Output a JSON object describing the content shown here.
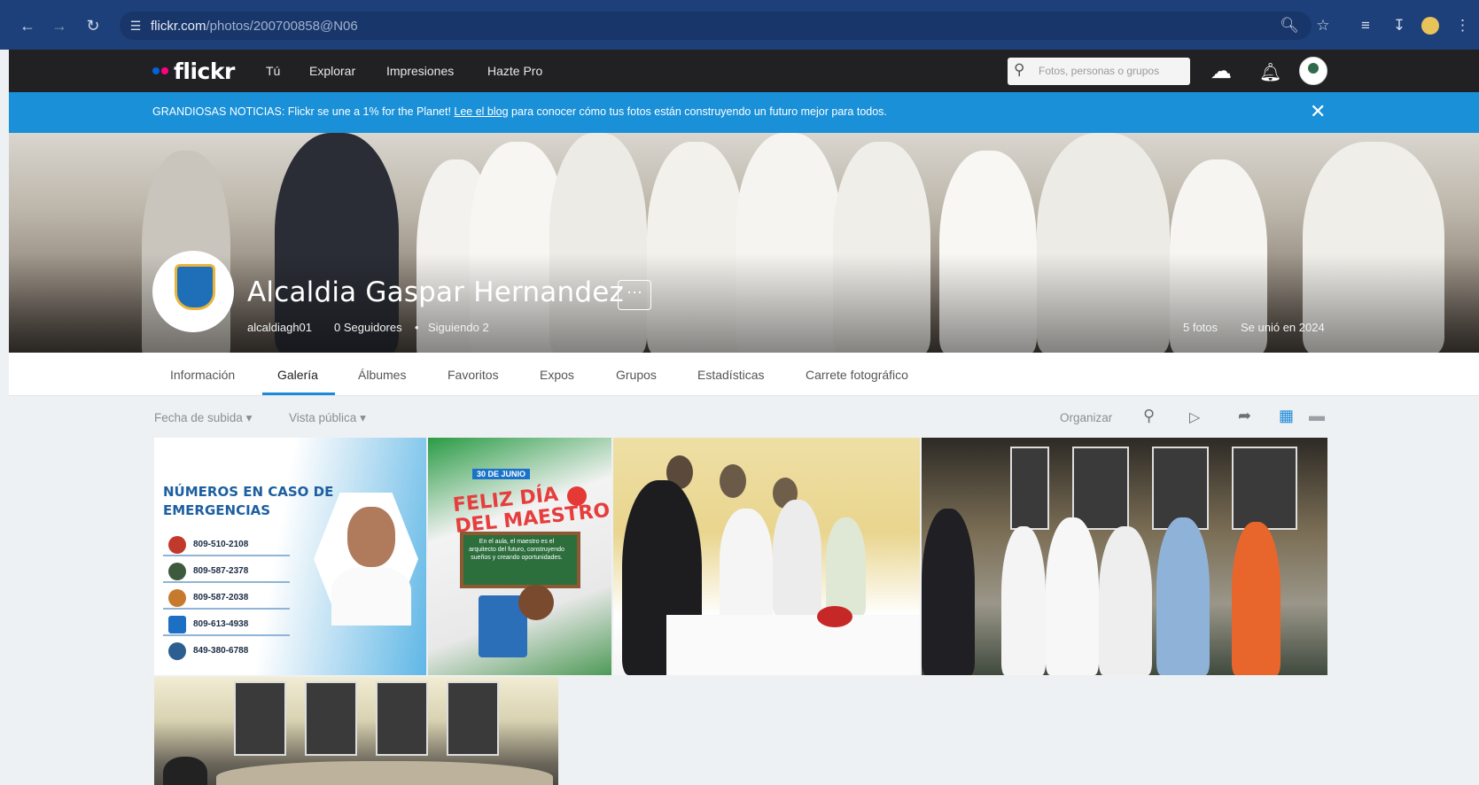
{
  "browser": {
    "url_host": "flickr.com",
    "url_path": "/photos/200700858@N06"
  },
  "flickr": {
    "logo": "flickr",
    "nav": [
      "Tú",
      "Explorar",
      "Impresiones",
      "Hazte Pro"
    ],
    "search_placeholder": "Fotos, personas o grupos"
  },
  "banner": {
    "prefix": "GRANDIOSAS NOTICIAS: Flickr se une a 1% for the Planet! ",
    "link": "Lee el blog",
    "suffix": " para conocer cómo tus fotos están construyendo un futuro mejor para todos."
  },
  "profile": {
    "name": "Alcaldia Gaspar Hernandez",
    "username": "alcaldiagh01",
    "followers": "0 Seguidores",
    "following": "Siguiendo 2",
    "photos": "5 fotos",
    "joined": "Se unió en 2024"
  },
  "tabs": [
    "Información",
    "Galería",
    "Álbumes",
    "Favoritos",
    "Expos",
    "Grupos",
    "Estadísticas",
    "Carrete fotográfico"
  ],
  "active_tab": "Galería",
  "toolbar": {
    "sort": "Fecha de subida",
    "view": "Vista pública",
    "organize": "Organizar"
  },
  "photo1": {
    "title_line1": "NÚMEROS EN CASO DE",
    "title_line2": "EMERGENCIAS",
    "numbers": [
      "809-510-2108",
      "809-587-2378",
      "809-587-2038",
      "809-613-4938",
      "849-380-6788"
    ]
  },
  "photo2": {
    "date": "30 DE JUNIO",
    "title_line1": "FELIZ DÍA",
    "title_line2": "DEL MAESTRO",
    "board_text": "En el aula, el maestro es el arquitecto del futuro, construyendo sueños y creando oportunidades."
  },
  "colors": {
    "chrome": "#1d3f7a",
    "flickr_bar": "#212124",
    "banner": "#1990d8",
    "accent": "#1a8ad9",
    "flickr_blue": "#0063dc",
    "flickr_pink": "#ff0084"
  }
}
